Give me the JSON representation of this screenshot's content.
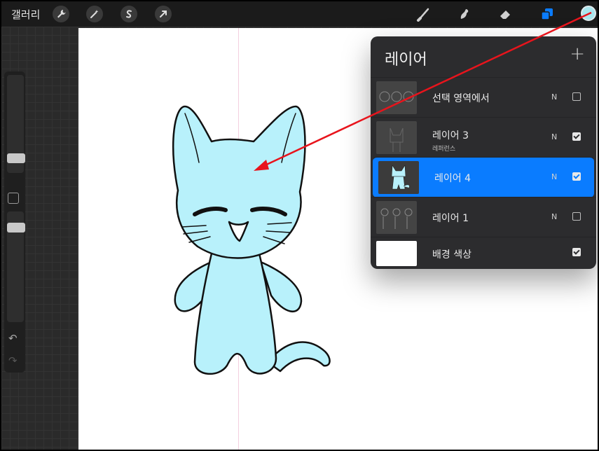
{
  "topbar": {
    "gallery_label": "갤러리",
    "left_tools": [
      "wrench-icon",
      "magic-wand-icon",
      "selection-icon",
      "transform-arrow-icon"
    ],
    "right_tools": [
      "brush-icon",
      "smudge-icon",
      "eraser-icon",
      "layers-icon"
    ],
    "current_color": "#a9e6ee"
  },
  "sidebar": {
    "brush_size_level": 0.3,
    "opacity_level": 0.5,
    "undo_icon": "undo-icon",
    "redo_icon": "redo-icon"
  },
  "layers_panel": {
    "title": "레이어",
    "add_icon": "+",
    "layers": [
      {
        "name": "선택 영역에서",
        "sub": "",
        "blend": "N",
        "visible": false,
        "active": false
      },
      {
        "name": "레이어 3",
        "sub": "레퍼런스",
        "blend": "N",
        "visible": true,
        "active": false
      },
      {
        "name": "레이어 4",
        "sub": "",
        "blend": "N",
        "visible": true,
        "active": true
      },
      {
        "name": "레이어 1",
        "sub": "",
        "blend": "N",
        "visible": false,
        "active": false
      }
    ],
    "background": {
      "name": "배경 색상",
      "visible": true
    }
  },
  "colors": {
    "accent": "#0a7cff",
    "cat_fill": "#b8f1fb",
    "annotation_arrow": "#e8141c"
  }
}
